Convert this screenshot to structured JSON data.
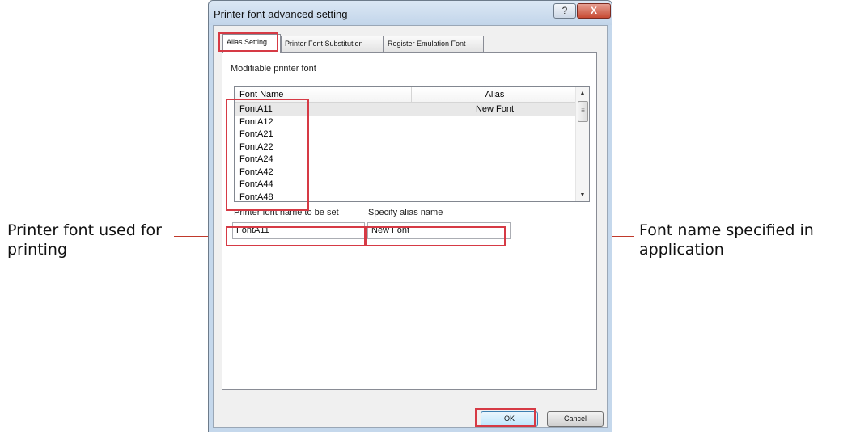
{
  "annotations": {
    "left_label": "Printer font used for\nprinting",
    "right_label": "Font name specified in\napplication"
  },
  "dialog": {
    "title": "Printer font advanced setting",
    "help_button": "?",
    "close_button": "X",
    "tabs": [
      {
        "label": "Alias Setting",
        "active": true
      },
      {
        "label": "Printer Font Substitution",
        "active": false
      },
      {
        "label": "Register Emulation Font",
        "active": false
      }
    ],
    "modifiable_label": "Modifiable printer font",
    "table": {
      "columns": [
        "Font Name",
        "Alias"
      ],
      "rows": [
        {
          "font": "FontA11",
          "alias": "New Font",
          "selected": true
        },
        {
          "font": "FontA12",
          "alias": ""
        },
        {
          "font": "FontA21",
          "alias": ""
        },
        {
          "font": "FontA22",
          "alias": ""
        },
        {
          "font": "FontA24",
          "alias": ""
        },
        {
          "font": "FontA42",
          "alias": ""
        },
        {
          "font": "FontA44",
          "alias": ""
        },
        {
          "font": "FontA48",
          "alias": ""
        }
      ]
    },
    "printer_font_label": "Printer font name to be set",
    "alias_label": "Specify alias name",
    "printer_font_value": "FontA11",
    "alias_value": "New Font",
    "ok_button": "OK",
    "cancel_button": "Cancel"
  },
  "colors": {
    "highlight": "#d63a45",
    "callout_line": "#c0392b",
    "window_frame": "#c5d8ec"
  }
}
